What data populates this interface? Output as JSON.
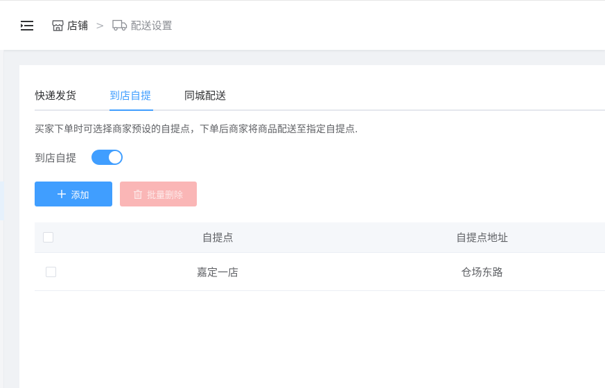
{
  "breadcrumb": {
    "store": "店铺",
    "separator": ">",
    "current": "配送设置"
  },
  "tabs": [
    {
      "label": "快递发货",
      "active": false
    },
    {
      "label": "到店自提",
      "active": true
    },
    {
      "label": "同城配送",
      "active": false
    }
  ],
  "description": "买家下单时可选择商家预设的自提点，下单后商家将商品配送至指定自提点.",
  "pickup_switch": {
    "label": "到店自提",
    "enabled": true
  },
  "buttons": {
    "add": "添加",
    "batch_delete": "批量删除"
  },
  "table": {
    "columns": [
      "自提点",
      "自提点地址"
    ],
    "rows": [
      {
        "name": "嘉定一店",
        "address": "仓场东路"
      }
    ]
  },
  "colors": {
    "primary": "#409eff",
    "danger_disabled": "#fab6b6",
    "header_bg": "#f5f7fa"
  },
  "icons": {
    "menu": "menu-fold-icon",
    "store": "store-icon",
    "truck": "truck-icon",
    "plus": "plus-icon",
    "trash": "trash-icon"
  }
}
